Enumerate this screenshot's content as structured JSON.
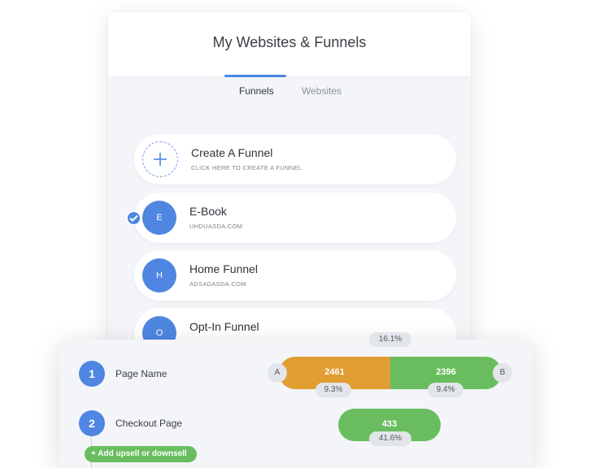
{
  "header": {
    "title": "My Websites & Funnels"
  },
  "tabs": [
    {
      "label": "Funnels",
      "active": true
    },
    {
      "label": "Websites",
      "active": false
    }
  ],
  "create": {
    "title": "Create A Funnel",
    "subtitle": "CLICK HERE TO CREATE A FUNNEL",
    "icon": "plus-icon"
  },
  "funnels": [
    {
      "initial": "E",
      "title": "E-Book",
      "domain": "UHDUASDA.COM",
      "selected": true
    },
    {
      "initial": "H",
      "title": "Home Funnel",
      "domain": "ADSADASDA.COM",
      "selected": false
    },
    {
      "initial": "O",
      "title": "Opt-In Funnel",
      "domain": "",
      "selected": false
    }
  ],
  "stats": {
    "top_partial_pct": "16.1%",
    "steps": [
      {
        "number": "1",
        "name": "Page Name"
      },
      {
        "number": "2",
        "name": "Checkout Page"
      }
    ],
    "split": {
      "a": {
        "letter": "A",
        "value": "2461",
        "pct": "9.3%"
      },
      "b": {
        "letter": "B",
        "value": "2396",
        "pct": "9.4%"
      }
    },
    "checkout": {
      "value": "433",
      "pct": "41.6%"
    },
    "add_button": "+ Add upsell or downsell"
  },
  "colors": {
    "accent": "#4e86e1",
    "orange": "#e09d31",
    "green": "#6abd5f",
    "panel_bg": "#f3f5f9"
  }
}
